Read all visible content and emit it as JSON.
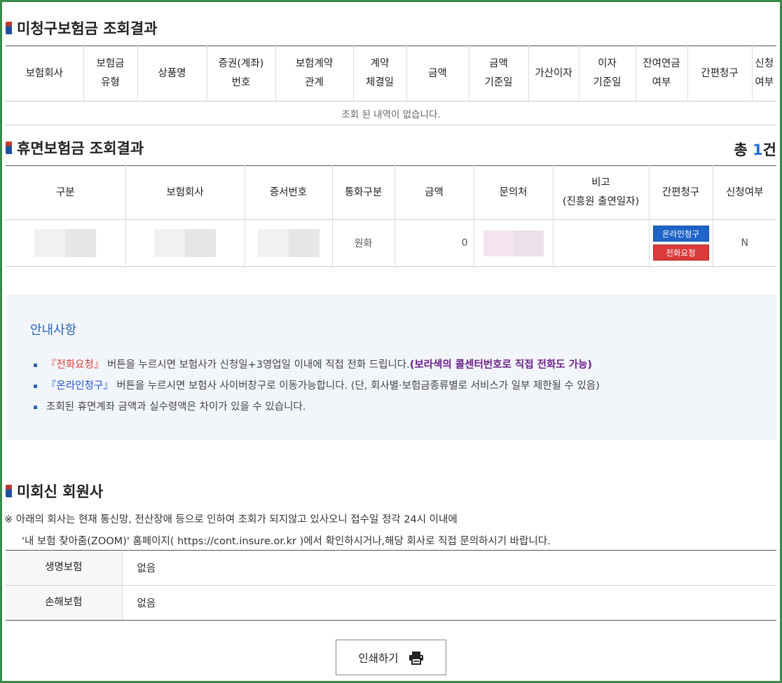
{
  "unclaimed": {
    "title": "미청구보험금 조회결과",
    "headers": [
      "보험회사",
      "보험금\n유형",
      "상품명",
      "증권(계좌)\n번호",
      "보험계약\n관계",
      "계약\n체결일",
      "금액",
      "금액\n기준일",
      "가산이자",
      "이자\n기준일",
      "잔여연금\n여부",
      "간편청구",
      "신청\n여부"
    ],
    "empty_message": "조회 된 내역이 없습니다."
  },
  "dormant": {
    "title": "휴면보험금 조회결과",
    "total_prefix": "총 ",
    "total_count": "1",
    "total_suffix": "건",
    "headers": [
      "구분",
      "보험회사",
      "증서번호",
      "통화구분",
      "금액",
      "문의처",
      "비고\n(진흥원 출연일자)",
      "간편청구",
      "신청여부"
    ],
    "rows": [
      {
        "currency": "원화",
        "amount": "0",
        "online_button": "온라인청구",
        "call_button": "전화요청",
        "applied": "N"
      }
    ]
  },
  "notice": {
    "title": "안내사항",
    "item1_highlight": "『전화요청』",
    "item1_text": "버튼을 누르시면 보험사가 신청일+3영업일 이내에 직접 전화 드립니다.",
    "item1_emphasis": "(보라색의 콜센터번호로 직접 전화도 가능)",
    "item2_highlight": "『온라인청구』",
    "item2_text": "버튼을 누르시면 보험사 사이버창구로 이동가능합니다. (단, 회사별·보험금종류별로 서비스가 일부 제한될 수 있음)",
    "item3_text": "조회된 휴면계좌 금액과 실수령액은 차이가 있을 수 있습니다."
  },
  "non_reply": {
    "title": "미회신 회원사",
    "note_line1": "※ 아래의 회사는 현재 통신망, 전산장애 등으로 인하여 조회가 되지않고 있사오니 접수일 정각 24시 이내에",
    "note_line2": "'내 보험 찾아줌(ZOOM)' 홈페이지( https://cont.insure.or.kr )에서 확인하시거나,해당 회사로 직접 문의하시기 바랍니다.",
    "rows": [
      {
        "label": "생명보험",
        "value": "없음"
      },
      {
        "label": "손해보험",
        "value": "없음"
      }
    ]
  },
  "print_button": "인쇄하기",
  "colors": {
    "frame": "#3a8a4a",
    "accent_blue": "#1f64c8",
    "accent_red": "#d93a3a",
    "emphasis_purple": "#6b1e8a",
    "notice_bg": "#f2f6fa"
  },
  "icons": {
    "print": "printer-icon",
    "section_marker": "section-marker-icon"
  }
}
